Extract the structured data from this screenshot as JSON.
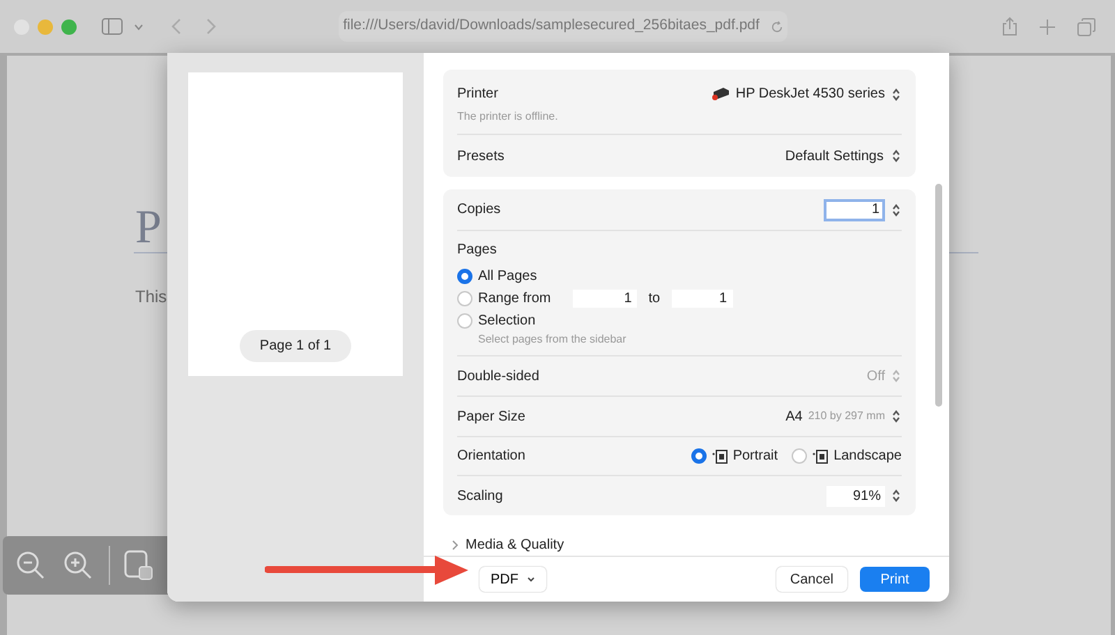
{
  "browser": {
    "url": "file:///Users/david/Downloads/samplesecured_256bitaes_pdf.pdf"
  },
  "document": {
    "heading": "P",
    "text": "This"
  },
  "print_dialog": {
    "preview": {
      "page_label": "Page 1 of 1"
    },
    "printer": {
      "label": "Printer",
      "value": "HP DeskJet 4530 series",
      "status": "The printer is offline."
    },
    "presets": {
      "label": "Presets",
      "value": "Default Settings"
    },
    "copies": {
      "label": "Copies",
      "value": "1"
    },
    "pages": {
      "label": "Pages",
      "options": [
        {
          "kind": "all",
          "label": "All Pages",
          "selected": true
        },
        {
          "kind": "range",
          "label": "Range from",
          "from": "1",
          "to_label": "to",
          "to": "1",
          "selected": false
        },
        {
          "kind": "selection",
          "label": "Selection",
          "hint": "Select pages from the sidebar",
          "selected": false
        }
      ]
    },
    "double_sided": {
      "label": "Double-sided",
      "value": "Off",
      "disabled": true
    },
    "paper_size": {
      "label": "Paper Size",
      "value": "A4",
      "detail": "210 by 297 mm"
    },
    "orientation": {
      "label": "Orientation",
      "options": [
        {
          "label": "Portrait",
          "selected": true
        },
        {
          "label": "Landscape",
          "selected": false
        }
      ]
    },
    "scaling": {
      "label": "Scaling",
      "value": "91%"
    },
    "media_quality": {
      "label": "Media & Quality",
      "expanded": false
    },
    "buttons": {
      "pdf": "PDF",
      "cancel": "Cancel",
      "print": "Print"
    }
  }
}
